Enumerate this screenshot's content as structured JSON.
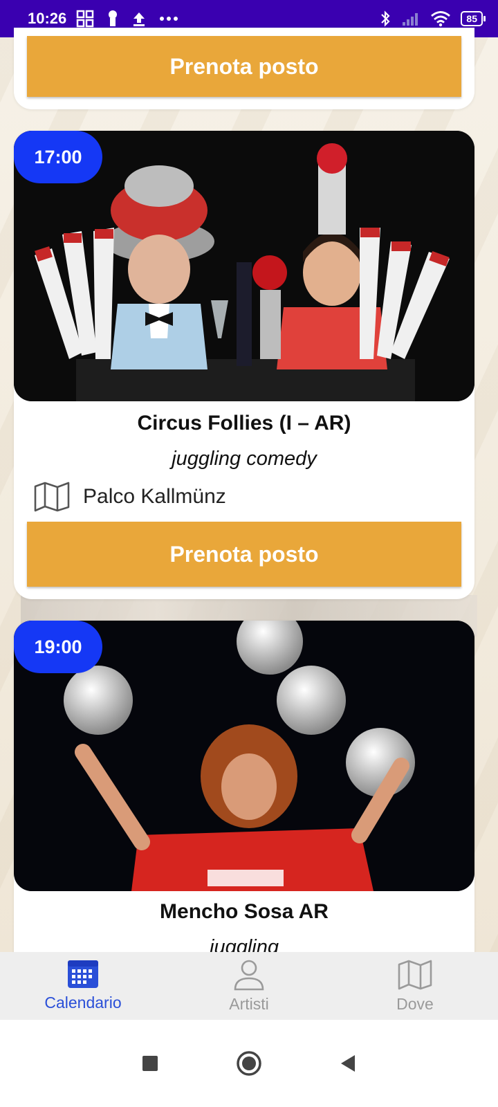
{
  "status_bar": {
    "time": "10:26",
    "battery": "85"
  },
  "events": [
    {
      "book_label": "Prenota posto"
    },
    {
      "time": "17:00",
      "title": "Circus Follies (I – AR)",
      "genre": "juggling comedy",
      "venue": "Palco Kallmünz",
      "book_label": "Prenota posto",
      "image_icon": "photo-juggling-duo"
    },
    {
      "time": "19:00",
      "title": "Mencho Sosa AR",
      "genre": "juggling",
      "image_icon": "photo-football-juggler"
    }
  ],
  "bottom_nav": [
    {
      "label": "Calendario",
      "icon": "calendar-icon",
      "active": true
    },
    {
      "label": "Artisti",
      "icon": "person-icon",
      "active": false
    },
    {
      "label": "Dove",
      "icon": "map-icon",
      "active": false
    }
  ],
  "colors": {
    "status_bar": "#3a00b0",
    "time_badge": "#1538f5",
    "book_button": "#e9a73a",
    "nav_active": "#2a4fd8"
  }
}
